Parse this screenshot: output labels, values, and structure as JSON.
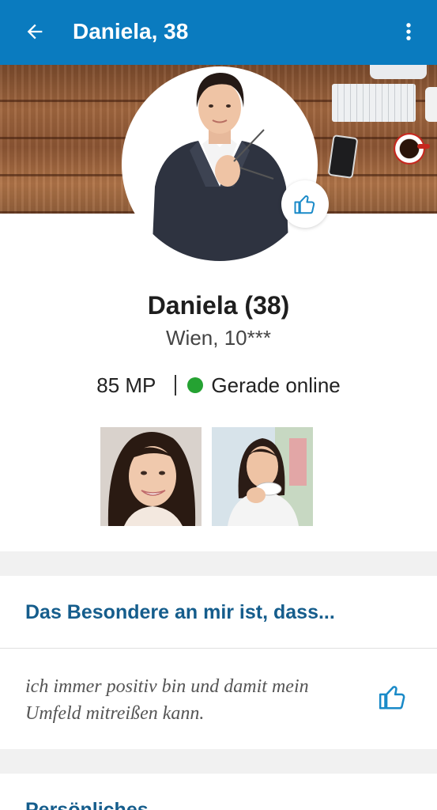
{
  "appbar": {
    "title": "Daniela, 38",
    "back_icon": "arrow-left-icon",
    "menu_icon": "more-vertical-icon",
    "color": "#0a7bbf"
  },
  "profile": {
    "name": "Daniela (38)",
    "location": "Wien, 10***",
    "points": "85 MP",
    "status": "Gerade online",
    "status_color": "#25a232",
    "like_icon": "thumbs-up-icon"
  },
  "photos": [
    {
      "alt_icon": "photo-thumbnail"
    },
    {
      "alt_icon": "photo-thumbnail"
    }
  ],
  "sections": [
    {
      "heading": "Das Besondere an mir ist, dass...",
      "text": "ich immer positiv bin und damit mein Umfeld mitreißen kann.",
      "like_icon": "thumbs-up-icon"
    },
    {
      "heading": "Persönliches"
    }
  ],
  "accent_color": "#155d8c"
}
